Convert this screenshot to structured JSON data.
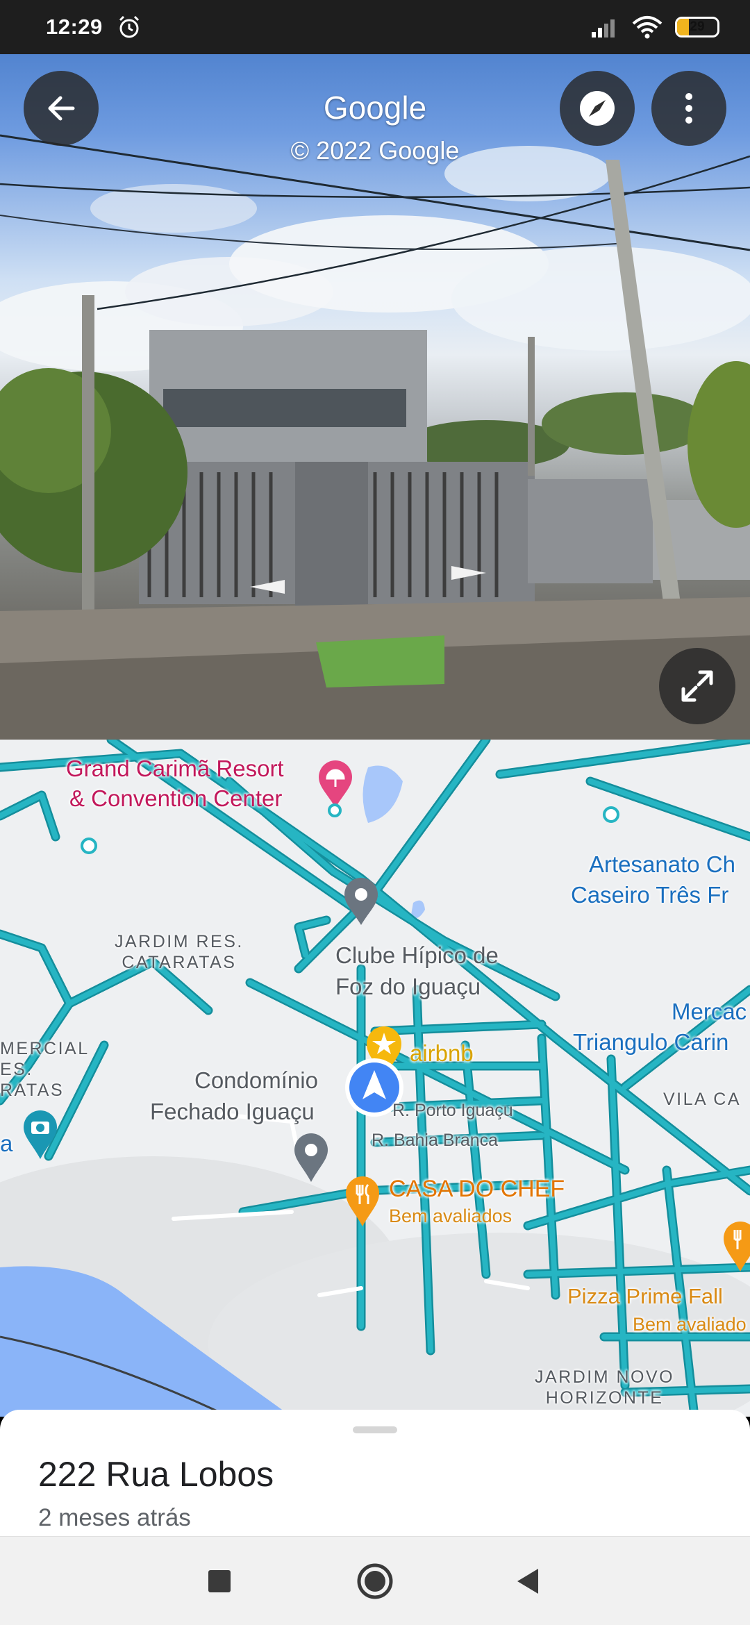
{
  "status_bar": {
    "time": "12:29",
    "battery_level": "29",
    "battery_fraction": 0.29,
    "icons": [
      "alarm-icon",
      "signal-icon",
      "wifi-icon",
      "battery-icon"
    ]
  },
  "header": {
    "title": "Google",
    "copyright": "© 2022 Google",
    "back_icon": "arrow-left-icon",
    "compass_icon": "compass-icon",
    "menu_icon": "more-vert-icon"
  },
  "street_view": {
    "expand_icon": "expand-icon"
  },
  "map": {
    "labels": {
      "resort_line1": "Grand Carimã Resort",
      "resort_line2": "& Convention Center",
      "artesanato_line1": "Artesanato Ch",
      "artesanato_line2": "Caseiro Três Fr",
      "jardim_res_line1": "JARDIM RES.",
      "jardim_res_line2": "CATARATAS",
      "clube_line1": "Clube Hípico de",
      "clube_line2": "Foz do Iguaçu",
      "mercado_line1": "Mercac",
      "mercado_line2": "Triangulo Carin",
      "comercial_line1": "MERCIAL",
      "comercial_line2": "ES.",
      "comercial_line3": "RATAS",
      "airbnb": "airbnb",
      "condominio_line1": "Condomínio",
      "condominio_line2": "Fechado Iguaçu",
      "vila": "VILA CA",
      "street_porto": "R. Porto Iguaçu",
      "street_bahia": "R. Bahia Branca",
      "left_edge": "a",
      "casa_chef": "CASA DO CHEF",
      "casa_chef_sub": "Bem avaliados",
      "pizza": "Pizza Prime Fall",
      "pizza_sub": "Bem avaliado",
      "jardim_novo_line1": "JARDIM NOVO",
      "jardim_novo_line2": "HORIZONTE"
    },
    "icons": [
      "pink-umbrella-pin-icon",
      "gray-place-pin-icon",
      "airbnb-star-pin-icon",
      "location-arrow-icon",
      "camera-pin-icon",
      "restaurant-pin-icon"
    ]
  },
  "bottom_sheet": {
    "address": "222 Rua Lobos",
    "date": "2 meses atrás"
  },
  "nav_bar": {
    "icons": [
      "recent-apps-icon",
      "home-icon",
      "back-triangle-icon"
    ]
  },
  "colors": {
    "road": "#26b5c3",
    "road_outline": "#148e9c",
    "water": "#8ab4f8",
    "poi_pink": "#c2185b",
    "poi_blue": "#1a6fbf",
    "poi_orange": "#e37400",
    "location_blue": "#4285f4"
  }
}
